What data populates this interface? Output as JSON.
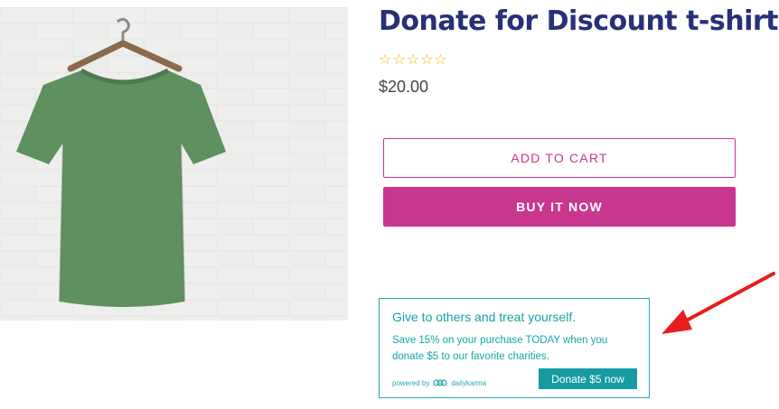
{
  "product": {
    "image_alt": "green t-shirt on hanger",
    "title": "Donate for Discount t-shirt",
    "rating_icons": [
      "star-outline-icon",
      "star-outline-icon",
      "star-outline-icon",
      "star-outline-icon",
      "star-outline-icon"
    ],
    "rating_star_glyph": "☆",
    "price": "$20.00"
  },
  "buttons": {
    "add_to_cart": "ADD TO CART",
    "buy_it_now": "BUY IT NOW"
  },
  "donation_widget": {
    "heading": "Give to others and treat yourself.",
    "body": "Save 15% on your purchase TODAY when you donate $5 to our favorite charities.",
    "powered_by": "powered by",
    "brand": "dailykarma",
    "button": "Donate $5 now"
  },
  "colors": {
    "title": "#283077",
    "accent": "#c8368f",
    "widget_teal": "#16a3a8",
    "star": "#f2b807",
    "arrow": "#e81c1c",
    "shirt": "#5f9060"
  },
  "annotation_icon": "red-arrow-icon"
}
